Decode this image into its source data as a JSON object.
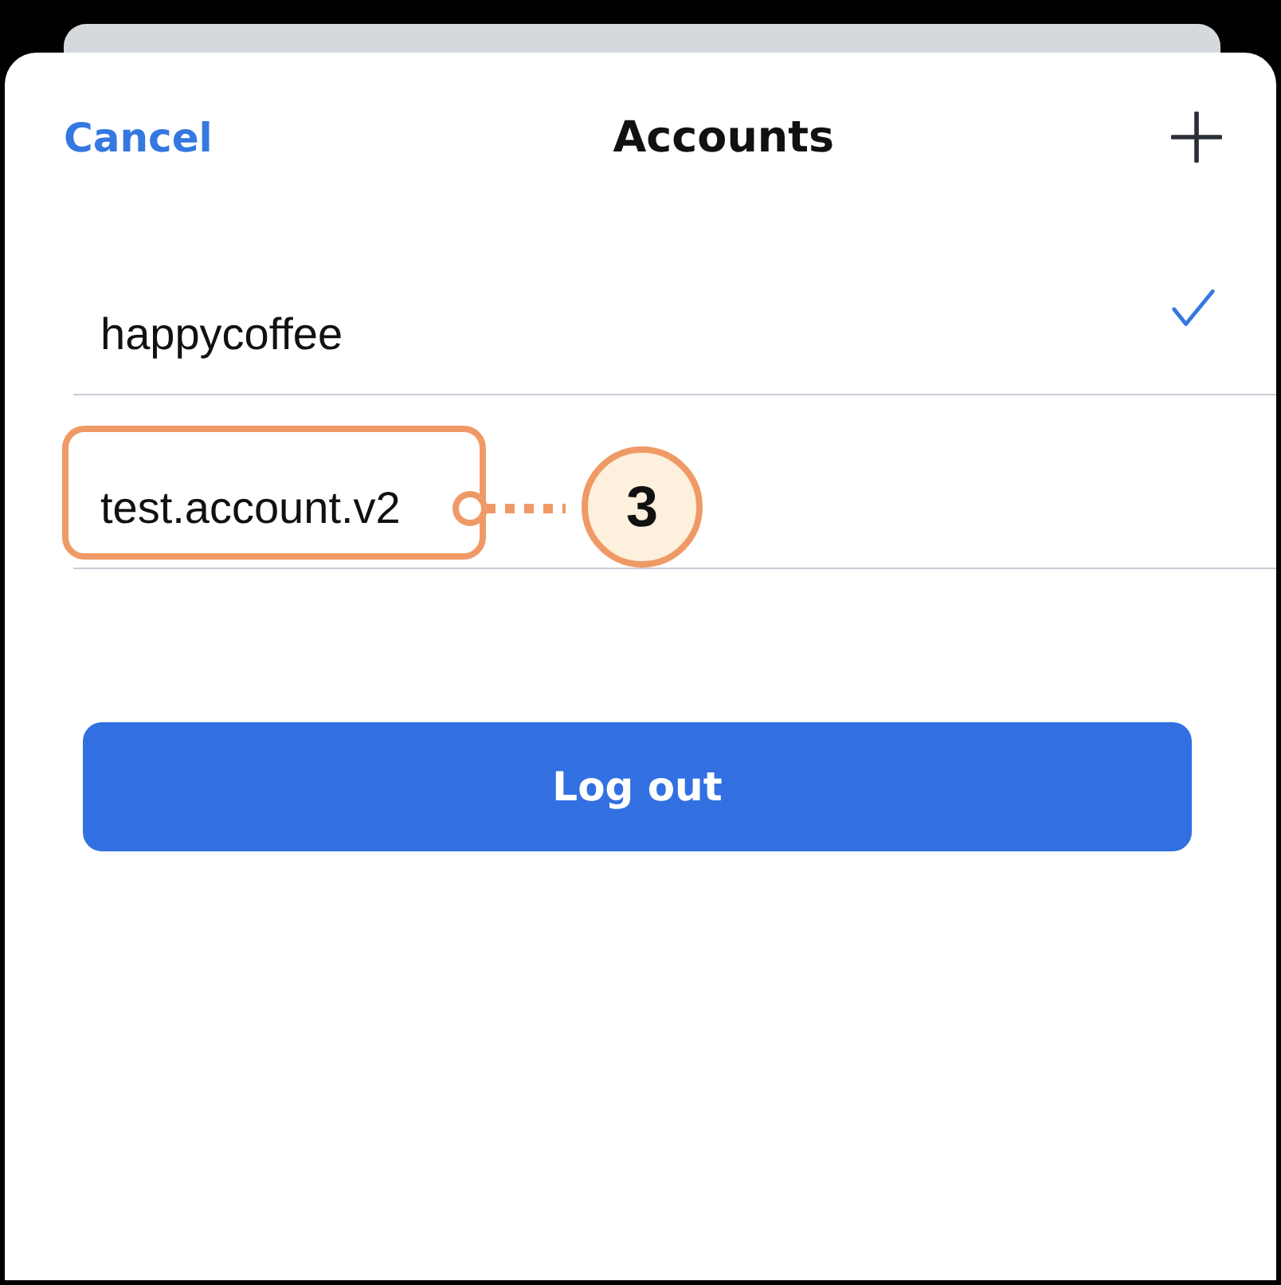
{
  "header": {
    "cancel": "Cancel",
    "title": "Accounts"
  },
  "accounts": [
    {
      "name": "happycoffee",
      "selected": true,
      "highlighted": false
    },
    {
      "name": "test.account.v2",
      "selected": false,
      "highlighted": true
    }
  ],
  "callout": {
    "label": "3"
  },
  "logout_button": "Log out"
}
